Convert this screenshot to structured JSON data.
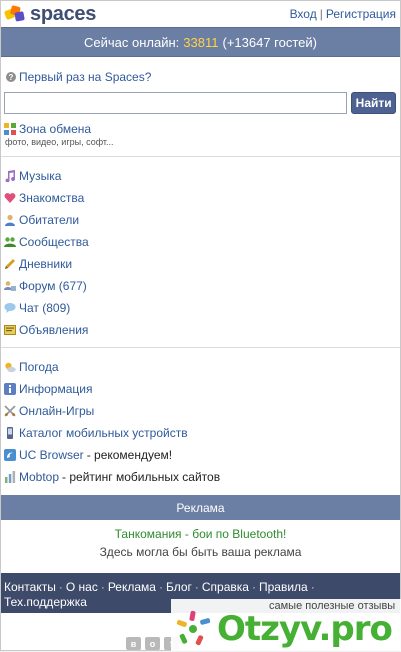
{
  "header": {
    "logo_text": "spaces",
    "login": "Вход",
    "separator": "|",
    "register": "Регистрация"
  },
  "online": {
    "prefix": "Сейчас онлайн:",
    "count": "33811",
    "guests": "(+13647 гостей)"
  },
  "first_time": "Первый раз на Spaces?",
  "search": {
    "value": "",
    "button": "Найти"
  },
  "zone": {
    "label": "Зона обмена",
    "sub": "фото, видео, игры, софт..."
  },
  "menu_main": [
    {
      "label": "Музыка",
      "icon": "music-icon",
      "color": "#9a6fc4"
    },
    {
      "label": "Знакомства",
      "icon": "heart-icon",
      "color": "#e0507a"
    },
    {
      "label": "Обитатели",
      "icon": "user-icon",
      "color": "#d9a14a"
    },
    {
      "label": "Сообщества",
      "icon": "community-icon",
      "color": "#5aa83a"
    },
    {
      "label": "Дневники",
      "icon": "pencil-icon",
      "color": "#d4a020"
    },
    {
      "label": "Форум (677)",
      "icon": "forum-icon",
      "color": "#6f8fb8"
    },
    {
      "label": "Чат (809)",
      "icon": "chat-icon",
      "color": "#7fb3e0"
    },
    {
      "label": "Объявления",
      "icon": "ads-icon",
      "color": "#c9a435"
    }
  ],
  "menu_extra": [
    {
      "label": "Погода",
      "suffix": "",
      "icon": "weather-icon",
      "color": "#f0b428"
    },
    {
      "label": "Информация",
      "suffix": "",
      "icon": "info-icon",
      "color": "#5b7fc0"
    },
    {
      "label": "Онлайн-Игры",
      "suffix": "",
      "icon": "swords-icon",
      "color": "#999999"
    },
    {
      "label": "Каталог мобильных устройств",
      "suffix": "",
      "icon": "phone-icon",
      "color": "#6b7fa8"
    },
    {
      "label": "UC Browser",
      "suffix": " - рекомендуем!",
      "icon": "ucbrowser-icon",
      "color": "#4a8fd0"
    },
    {
      "label": "Mobtop",
      "suffix": " - рейтинг мобильных сайтов",
      "icon": "chart-icon",
      "color": "#7fb070"
    }
  ],
  "ad": {
    "title": "Реклама",
    "link": "Танкомания - бои по Bluetooth!",
    "note": "Здесь могла бы быть ваша реклама"
  },
  "footer": {
    "links": [
      "Контакты",
      "О нас",
      "Реклама",
      "Блог",
      "Справка",
      "Правила"
    ],
    "support": "Тех.поддержка"
  },
  "social": [
    "в",
    "о",
    "f"
  ],
  "watermark": {
    "tagline": "самые полезные отзывы",
    "brand": "Otzyv.pro"
  }
}
